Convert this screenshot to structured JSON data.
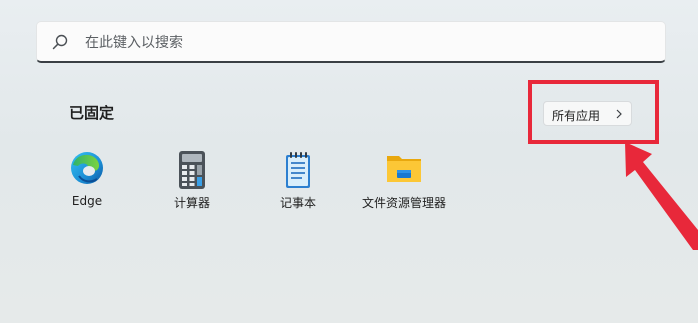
{
  "search": {
    "placeholder": "在此键入以搜索",
    "icon": "search-icon"
  },
  "pinned": {
    "title": "已固定",
    "all_apps_label": "所有应用",
    "all_apps_chevron": "chevron-right-icon",
    "apps": [
      {
        "label": "Edge",
        "icon": "edge-icon"
      },
      {
        "label": "计算器",
        "icon": "calculator-icon"
      },
      {
        "label": "记事本",
        "icon": "notepad-icon"
      },
      {
        "label": "文件资源管理器",
        "icon": "file-explorer-icon"
      }
    ]
  },
  "annotation": {
    "highlight_color": "#e8283a",
    "arrow_color": "#e8283a"
  }
}
